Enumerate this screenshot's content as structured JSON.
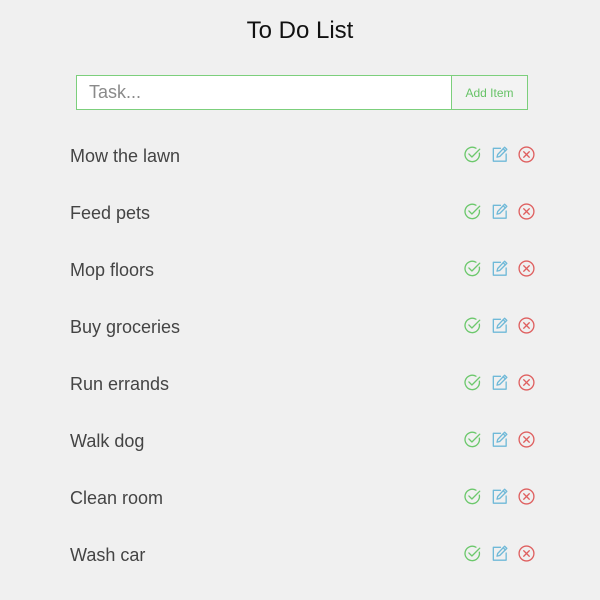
{
  "header": {
    "title": "To Do List"
  },
  "form": {
    "placeholder": "Task...",
    "value": "",
    "add_label": "Add Item"
  },
  "colors": {
    "complete": "#6cc86c",
    "edit": "#6fb9d8",
    "delete": "#df6060",
    "border": "#7ccf7c"
  },
  "icons": {
    "complete": "check-circle-icon",
    "edit": "edit-icon",
    "delete": "close-circle-icon"
  },
  "todos": [
    {
      "text": "Mow the lawn"
    },
    {
      "text": "Feed pets"
    },
    {
      "text": "Mop floors"
    },
    {
      "text": "Buy groceries"
    },
    {
      "text": "Run errands"
    },
    {
      "text": "Walk dog"
    },
    {
      "text": "Clean room"
    },
    {
      "text": "Wash car"
    }
  ]
}
